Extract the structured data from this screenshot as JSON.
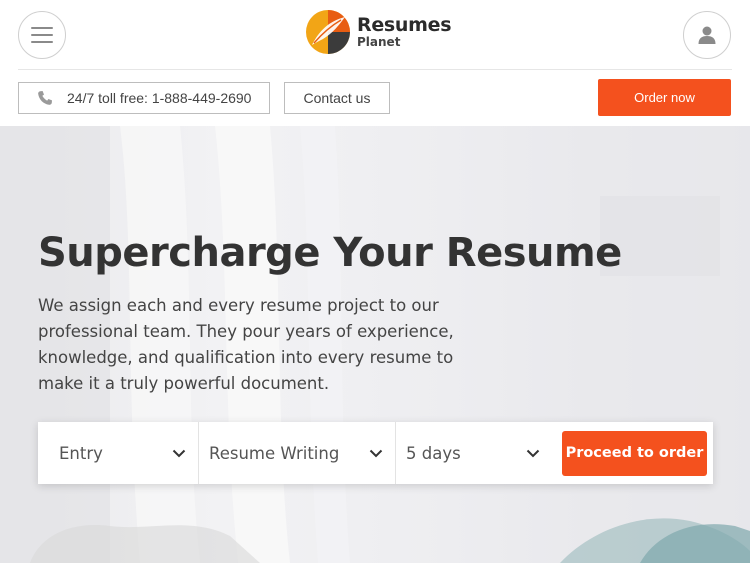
{
  "header": {
    "logo": {
      "name": "Resumes",
      "sub": "Planet"
    },
    "menu_icon": "hamburger-menu-icon",
    "user_icon": "user-icon"
  },
  "actions": {
    "phone_icon": "phone-icon",
    "phone_text": "24/7 toll free: 1-888-449-2690",
    "contact_label": "Contact us",
    "order_label": "Order now"
  },
  "hero": {
    "title": "Supercharge Your Resume",
    "description": "We assign each and every resume project to our professional team. They pour years of experience, knowledge, and qualification into every resume to make it a truly powerful document."
  },
  "order_form": {
    "level": "Entry",
    "service": "Resume Writing",
    "deadline": "5 days",
    "submit_label": "Proceed to order"
  },
  "colors": {
    "accent": "#f4511e",
    "text": "#333333",
    "border": "#bdbdbd"
  }
}
